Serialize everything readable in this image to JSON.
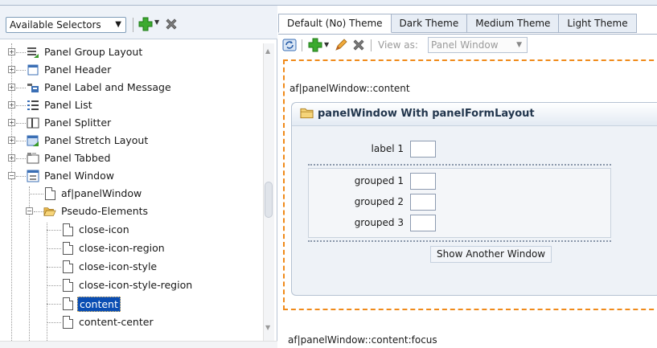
{
  "left_toolbar": {
    "selector_value": "Available Selectors"
  },
  "tree": {
    "items": [
      {
        "label": "Panel Group Layout",
        "icon": "panel-group-layout-icon"
      },
      {
        "label": "Panel Header",
        "icon": "panel-header-icon"
      },
      {
        "label": "Panel Label and Message",
        "icon": "panel-label-message-icon"
      },
      {
        "label": "Panel List",
        "icon": "panel-list-icon"
      },
      {
        "label": "Panel Splitter",
        "icon": "panel-splitter-icon"
      },
      {
        "label": "Panel Stretch Layout",
        "icon": "panel-stretch-layout-icon"
      },
      {
        "label": "Panel Tabbed",
        "icon": "panel-tabbed-icon"
      },
      {
        "label": "Panel Window",
        "icon": "panel-window-icon"
      },
      {
        "label": "af|panelWindow",
        "icon": "page-icon"
      },
      {
        "label": "Pseudo-Elements",
        "icon": "folder-open-icon"
      },
      {
        "label": "close-icon",
        "icon": "page-icon"
      },
      {
        "label": "close-icon-region",
        "icon": "page-icon"
      },
      {
        "label": "close-icon-style",
        "icon": "page-icon"
      },
      {
        "label": "close-icon-style-region",
        "icon": "page-icon"
      },
      {
        "label": "content",
        "icon": "page-icon",
        "selected": true
      },
      {
        "label": "content-center",
        "icon": "page-icon"
      }
    ]
  },
  "tabs": [
    {
      "label": "Default (No) Theme",
      "active": true
    },
    {
      "label": "Dark Theme"
    },
    {
      "label": "Medium Theme"
    },
    {
      "label": "Light Theme"
    }
  ],
  "right_toolbar": {
    "view_as_label": "View as:",
    "view_as_value": "Panel Window"
  },
  "preview": {
    "selector_title": "af|panelWindow::content",
    "panel_title": "panelWindow With panelFormLayout",
    "fields": [
      {
        "label": "label 1",
        "value": ""
      },
      {
        "label": "grouped 1",
        "value": ""
      },
      {
        "label": "grouped 2",
        "value": ""
      },
      {
        "label": "grouped 3",
        "value": ""
      }
    ],
    "button_label": "Show Another Window",
    "next_selector_title": "af|panelWindow::content:focus"
  },
  "colors": {
    "selection": "#0a4db3",
    "focus_border": "#f08a1a",
    "panel_title": "#22364d",
    "add_icon": "#3caa2f",
    "delete_icon": "#7a7a7a"
  }
}
